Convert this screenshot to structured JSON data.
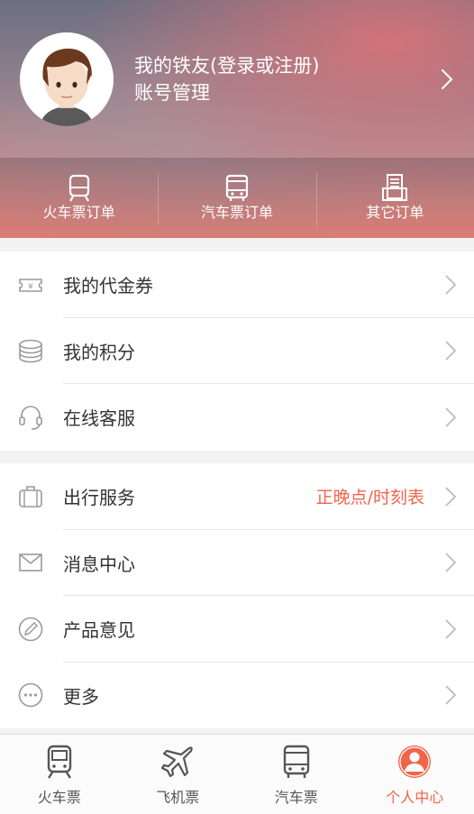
{
  "header": {
    "user_name": "我的铁友(登录或注册)",
    "account_label": "账号管理",
    "orders": [
      {
        "label": "火车票订单",
        "icon": "train-icon"
      },
      {
        "label": "汽车票订单",
        "icon": "bus-icon"
      },
      {
        "label": "其它订单",
        "icon": "other-orders-icon"
      }
    ]
  },
  "group1": [
    {
      "label": "我的代金券",
      "icon": "voucher-icon"
    },
    {
      "label": "我的积分",
      "icon": "points-icon"
    },
    {
      "label": "在线客服",
      "icon": "headset-icon"
    }
  ],
  "group2": [
    {
      "label": "出行服务",
      "icon": "luggage-icon",
      "extra": "正晚点/时刻表"
    },
    {
      "label": "消息中心",
      "icon": "mail-icon"
    },
    {
      "label": "产品意见",
      "icon": "pen-icon"
    },
    {
      "label": "更多",
      "icon": "more-icon"
    }
  ],
  "tabs": [
    {
      "label": "火车票",
      "icon": "train-icon"
    },
    {
      "label": "飞机票",
      "icon": "plane-icon"
    },
    {
      "label": "汽车票",
      "icon": "bus-icon"
    },
    {
      "label": "个人中心",
      "icon": "profile-icon",
      "active": true
    }
  ],
  "colors": {
    "accent": "#f0654a",
    "text": "#333333",
    "icon": "#9a9a9a"
  }
}
